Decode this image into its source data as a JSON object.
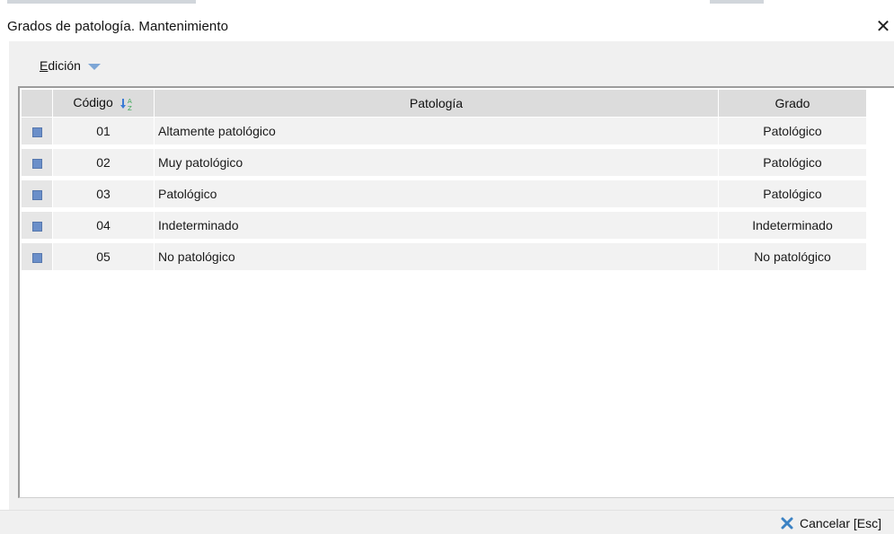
{
  "window": {
    "title": "Grados de patología. Mantenimiento",
    "close_glyph": "✕"
  },
  "menu": {
    "edicion_label": "Edición",
    "edicion_icon": "chevron-down-icon"
  },
  "grid": {
    "columns": {
      "codigo": "Código",
      "patologia": "Patología",
      "grado": "Grado"
    },
    "sort_icon": "sort-az-icon",
    "rows": [
      {
        "codigo": "01",
        "patologia": "Altamente patológico",
        "grado": "Patológico"
      },
      {
        "codigo": "02",
        "patologia": "Muy patológico",
        "grado": "Patológico"
      },
      {
        "codigo": "03",
        "patologia": "Patológico",
        "grado": "Patológico"
      },
      {
        "codigo": "04",
        "patologia": "Indeterminado",
        "grado": "Indeterminado"
      },
      {
        "codigo": "05",
        "patologia": "No patológico",
        "grado": "No patológico"
      }
    ]
  },
  "footer": {
    "cancel_label": "Cancelar [Esc]",
    "cancel_icon": "close-x-icon"
  },
  "colors": {
    "accent": "#7da6d6",
    "row_marker": "#6b8fc9",
    "cancel_icon": "#3b82c4"
  }
}
